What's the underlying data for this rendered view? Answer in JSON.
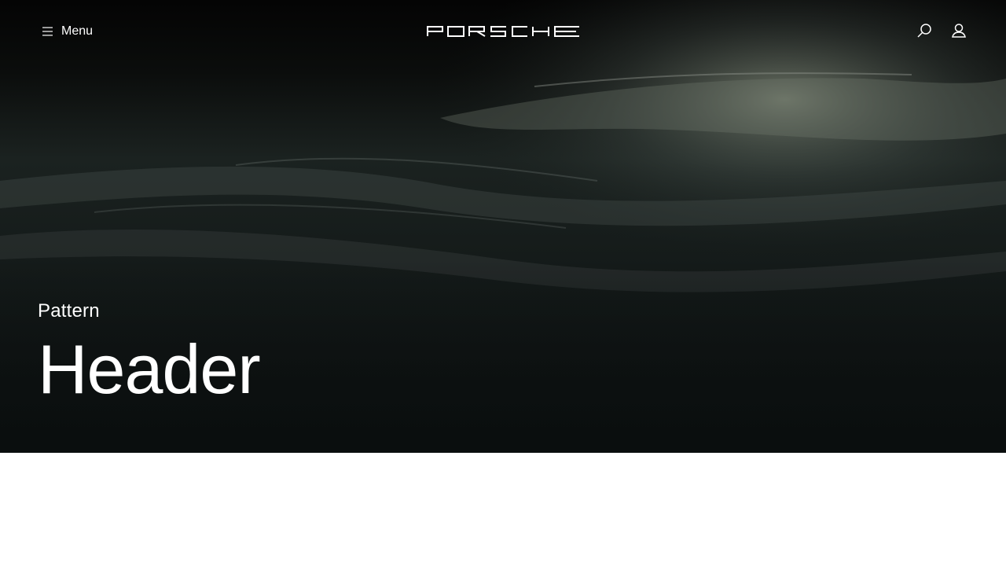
{
  "header": {
    "menu_label": "Menu",
    "logo_text": "PORSCHE",
    "icons": {
      "menu": "hamburger-icon",
      "search": "search-icon",
      "account": "user-icon"
    }
  },
  "hero": {
    "eyebrow": "Pattern",
    "title": "Header"
  },
  "colors": {
    "text": "#ffffff",
    "hero_dark": "#0c1010",
    "page_bg": "#ffffff"
  }
}
